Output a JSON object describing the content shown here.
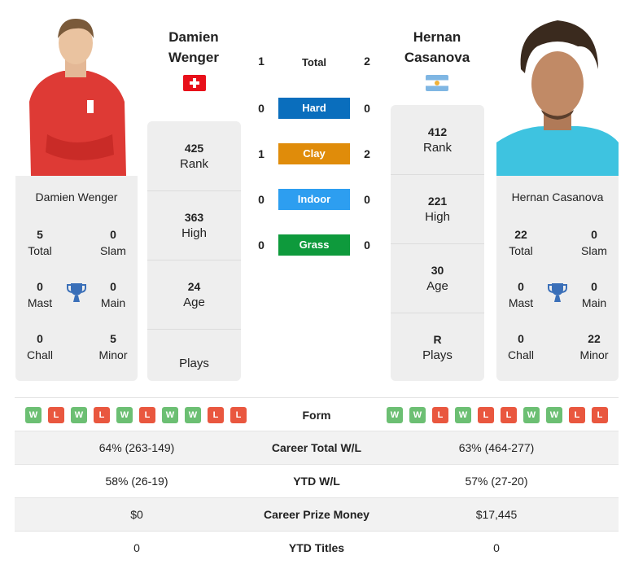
{
  "player1": {
    "name": "Damien Wenger",
    "name_line1": "Damien",
    "name_line2": "Wenger",
    "flag": "switzerland-flag",
    "rank": "425",
    "rank_label": "Rank",
    "high": "363",
    "high_label": "High",
    "age": "24",
    "age_label": "Age",
    "plays": "",
    "plays_label": "Plays",
    "titles": {
      "total": "5",
      "total_label": "Total",
      "slam": "0",
      "slam_label": "Slam",
      "mast": "0",
      "mast_label": "Mast",
      "main": "0",
      "main_label": "Main",
      "chall": "0",
      "chall_label": "Chall",
      "minor": "5",
      "minor_label": "Minor"
    },
    "form": [
      "W",
      "L",
      "W",
      "L",
      "W",
      "L",
      "W",
      "W",
      "L",
      "L"
    ]
  },
  "player2": {
    "name": "Hernan Casanova",
    "name_line1": "Hernan",
    "name_line2": "Casanova",
    "flag": "argentina-flag",
    "rank": "412",
    "rank_label": "Rank",
    "high": "221",
    "high_label": "High",
    "age": "30",
    "age_label": "Age",
    "plays": "R",
    "plays_label": "Plays",
    "titles": {
      "total": "22",
      "total_label": "Total",
      "slam": "0",
      "slam_label": "Slam",
      "mast": "0",
      "mast_label": "Mast",
      "main": "0",
      "main_label": "Main",
      "chall": "0",
      "chall_label": "Chall",
      "minor": "22",
      "minor_label": "Minor"
    },
    "form": [
      "W",
      "W",
      "L",
      "W",
      "L",
      "L",
      "W",
      "W",
      "L",
      "L"
    ]
  },
  "h2h": {
    "total": {
      "label": "Total",
      "p1": "1",
      "p2": "2"
    },
    "surfaces": [
      {
        "label": "Hard",
        "p1": "0",
        "p2": "0",
        "color": "#0a6ebd"
      },
      {
        "label": "Clay",
        "p1": "1",
        "p2": "2",
        "color": "#e08c0a"
      },
      {
        "label": "Indoor",
        "p1": "0",
        "p2": "0",
        "color": "#2d9ef0"
      },
      {
        "label": "Grass",
        "p1": "0",
        "p2": "0",
        "color": "#0e9a3c"
      }
    ]
  },
  "form_label": "Form",
  "comparison": [
    {
      "label": "Career Total W/L",
      "p1": "64% (263-149)",
      "p2": "63% (464-277)"
    },
    {
      "label": "YTD W/L",
      "p1": "58% (26-19)",
      "p2": "57% (27-20)"
    },
    {
      "label": "Career Prize Money",
      "p1": "$0",
      "p2": "$17,445"
    },
    {
      "label": "YTD Titles",
      "p1": "0",
      "p2": "0"
    }
  ]
}
